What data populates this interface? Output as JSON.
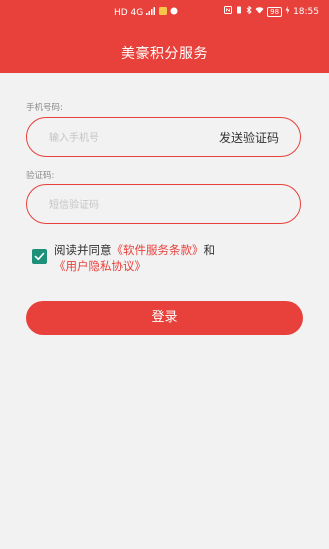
{
  "status_bar": {
    "left_signal": "HD 4G",
    "time": "18:55",
    "battery": "98"
  },
  "header": {
    "title": "美豪积分服务"
  },
  "form": {
    "phone_label": "手机号码:",
    "phone_placeholder": "输入手机号",
    "send_code_label": "发送验证码",
    "code_label": "验证码:",
    "code_placeholder": "短信验证码"
  },
  "agreement": {
    "checked": true,
    "prefix": "阅读并同意",
    "software_terms": "《软件服务条款》",
    "and": "和",
    "privacy_policy": "《用户隐私协议》"
  },
  "login": {
    "label": "登录"
  },
  "colors": {
    "accent": "#e8403a",
    "checkbox": "#1e8f79"
  }
}
